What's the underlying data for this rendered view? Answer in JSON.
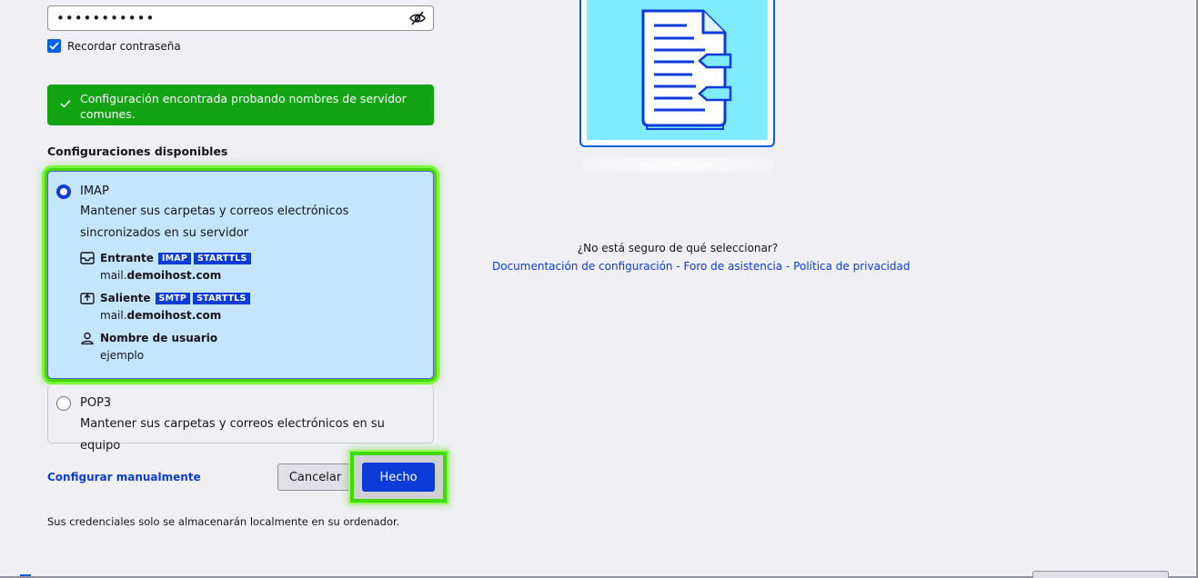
{
  "password": {
    "value": "•••••••••••",
    "toggle_icon": "eye-slash-icon"
  },
  "remember": {
    "label": "Recordar contraseña",
    "checked": true
  },
  "success": {
    "text": "Configuración encontrada probando nombres de servidor comunes.",
    "color": "#12a412"
  },
  "configs": {
    "title": "Configuraciones disponibles",
    "imap": {
      "title": "IMAP",
      "description": "Mantener sus carpetas y correos electrónicos sincronizados en su servidor",
      "incoming": {
        "label": "Entrante",
        "tags": [
          "IMAP",
          "STARTTLS"
        ],
        "host_prefix": "mail.",
        "host_domain": "demoihost.com"
      },
      "outgoing": {
        "label": "Saliente",
        "tags": [
          "SMTP",
          "STARTTLS"
        ],
        "host_prefix": "mail.",
        "host_domain": "demoihost.com"
      },
      "username": {
        "label": "Nombre de usuario",
        "value": "ejemplo"
      },
      "selected": true
    },
    "pop3": {
      "title": "POP3",
      "description": "Mantener sus carpetas y correos electrónicos en su equipo",
      "selected": false
    }
  },
  "actions": {
    "manual": "Configurar manualmente",
    "cancel": "Cancelar",
    "done": "Hecho"
  },
  "footer_note": "Sus credenciales solo se almacenarán localmente en su ordenador.",
  "help": {
    "question": "¿No está seguro de qué seleccionar?",
    "link_docs": "Documentación de configuración",
    "link_forum": "Foro de asistencia",
    "link_privacy": "Política de privacidad",
    "separator": "-"
  },
  "colors": {
    "accent": "#0b3bd9",
    "highlight": "#44d800",
    "selected_card": "#c5e5fd"
  }
}
